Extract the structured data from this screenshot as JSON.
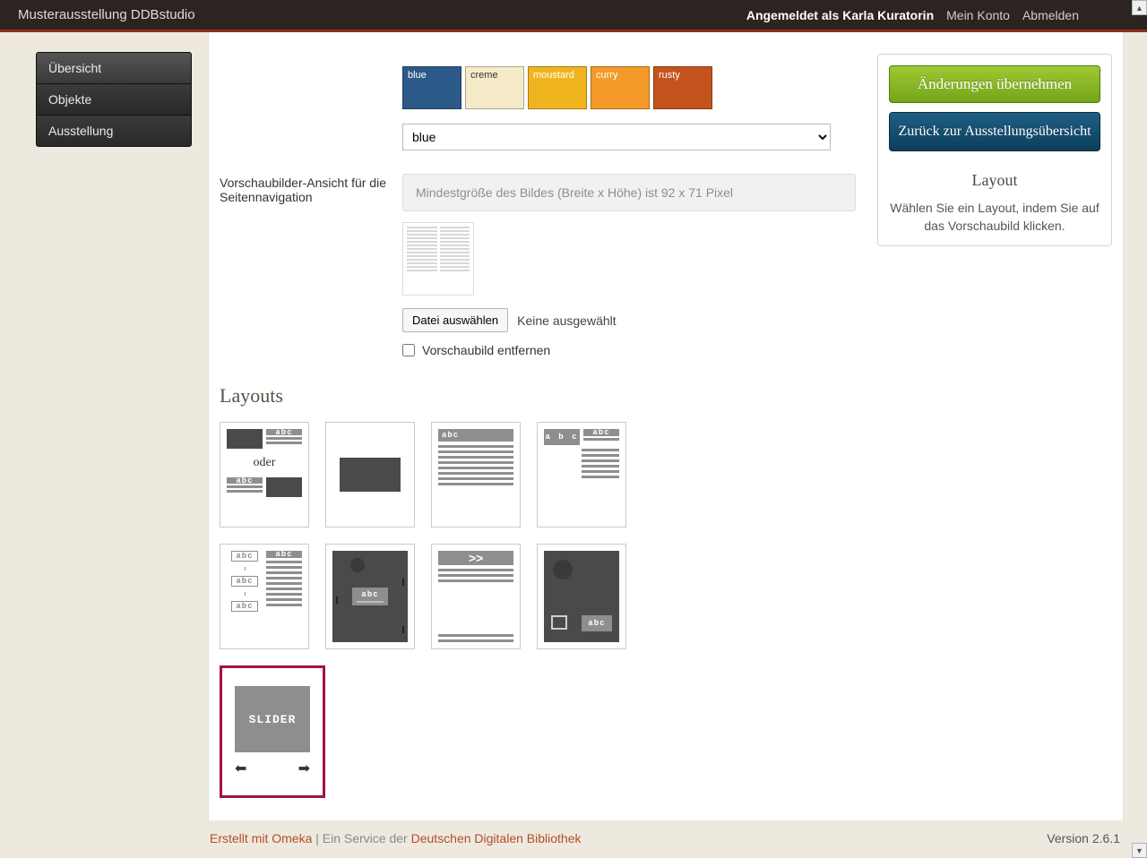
{
  "topbar": {
    "brand": "Musterausstellung DDBstudio",
    "logged_in_as": "Angemeldet als Karla Kuratorin",
    "my_account": "Mein Konto",
    "logout": "Abmelden"
  },
  "sidebar": {
    "items": [
      {
        "label": "Übersicht"
      },
      {
        "label": "Objekte"
      },
      {
        "label": "Ausstellung"
      }
    ]
  },
  "palette": {
    "swatches": [
      {
        "name": "blue",
        "hex": "#2c5a88",
        "light": false
      },
      {
        "name": "creme",
        "hex": "#f6ebc9",
        "light": true
      },
      {
        "name": "moustard",
        "hex": "#f0b41f",
        "light": false
      },
      {
        "name": "curry",
        "hex": "#f39a2a",
        "light": false
      },
      {
        "name": "rusty",
        "hex": "#c3541e",
        "light": false
      }
    ],
    "selected": "blue"
  },
  "thumbnail_section": {
    "label": "Vorschaubilder-Ansicht für die Seitennavigation",
    "hint": "Mindestgröße des Bildes (Breite x Höhe) ist 92 x 71 Pixel",
    "file_button": "Datei auswählen",
    "file_status": "Keine ausgewählt",
    "remove_label": "Vorschaubild entfernen"
  },
  "layouts": {
    "heading": "Layouts",
    "oder": "oder",
    "slider_label": "SLIDER",
    "chevrons": ">>"
  },
  "aside": {
    "apply": "Änderungen übernehmen",
    "back": "Zurück zur Ausstellungsübersicht",
    "layout_heading": "Layout",
    "layout_help": "Wählen Sie ein Layout, indem Sie auf das Vorschaubild klicken."
  },
  "footer": {
    "made_with": "Erstellt mit Omeka",
    "mid": " | Ein Service der ",
    "ddb": "Deutschen Digitalen Bibliothek",
    "version": "Version 2.6.1"
  }
}
